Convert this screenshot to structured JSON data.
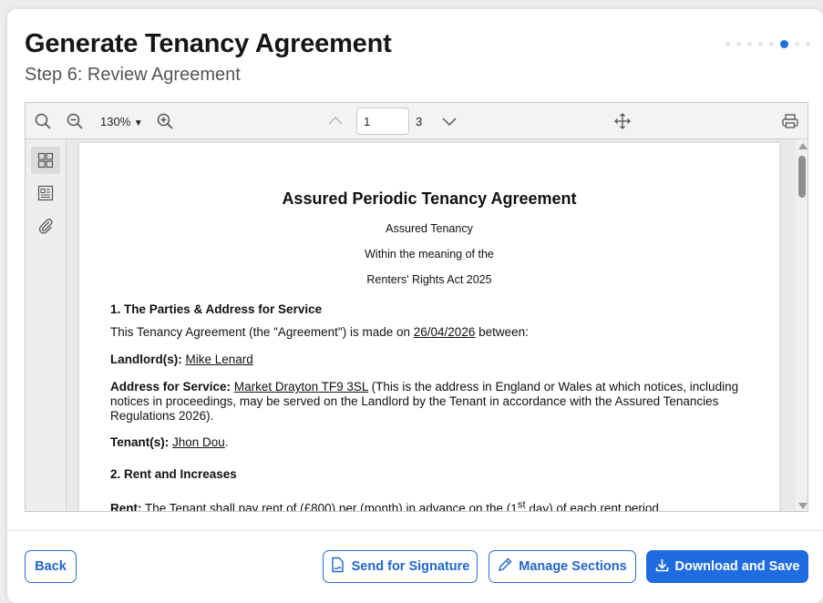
{
  "header": {
    "title": "Generate Tenancy Agreement",
    "subtitle": "Step 6: Review Agreement",
    "step_total": 8,
    "step_current": 6
  },
  "viewer": {
    "zoom": "130%",
    "page_current": "1",
    "page_total": "3",
    "icons": {
      "search": "search-icon",
      "zoom_out": "zoom-out-icon",
      "zoom_in": "zoom-in-icon",
      "prev": "chevron-up-icon",
      "next": "chevron-down-icon",
      "pan": "pan-move-icon",
      "print": "printer-icon",
      "thumbnails": "thumbnails-icon",
      "outline": "outline-icon",
      "attachments": "paperclip-icon"
    }
  },
  "document": {
    "title": "Assured Periodic Tenancy Agreement",
    "subtitle1": "Assured Tenancy",
    "subtitle2": "Within the meaning of the",
    "subtitle3": "Renters' Rights Act 2025",
    "s1_heading": "1. The Parties & Address for Service",
    "s1_intro_pre": "This Tenancy Agreement (the \"Agreement\") is made on ",
    "s1_date": "26/04/2026",
    "s1_intro_post": " between:",
    "landlord_label": "Landlord(s):",
    "landlord_name": "Mike Lenard",
    "address_label": "Address for Service:",
    "address_value": "Market Drayton TF9 3SL",
    "address_note": " (This is the address in England or Wales at which notices, including notices in proceedings, may be served on the Landlord by the Tenant in accordance with the Assured Tenancies Regulations 2026).",
    "tenant_label": "Tenant(s):",
    "tenant_name": "Jhon Dou",
    "tenant_end": ".",
    "s2_heading": "2. Rent and Increases",
    "rent_label": "Rent:",
    "rent_pre": " The Tenant shall pay rent of (",
    "rent_amount": "£800",
    "rent_mid": ") per (",
    "rent_period": "month",
    "rent_mid2": ") in advance on the (",
    "rent_day": "1",
    "rent_day_sup": "st",
    "rent_day_post": " day",
    "rent_end": ") of each rent period."
  },
  "footer": {
    "back": "Back",
    "send": "Send for Signature",
    "manage": "Manage Sections",
    "download": "Download and Save"
  },
  "colors": {
    "accent": "#1f6be0",
    "active_dot": "#1f6fd6"
  }
}
